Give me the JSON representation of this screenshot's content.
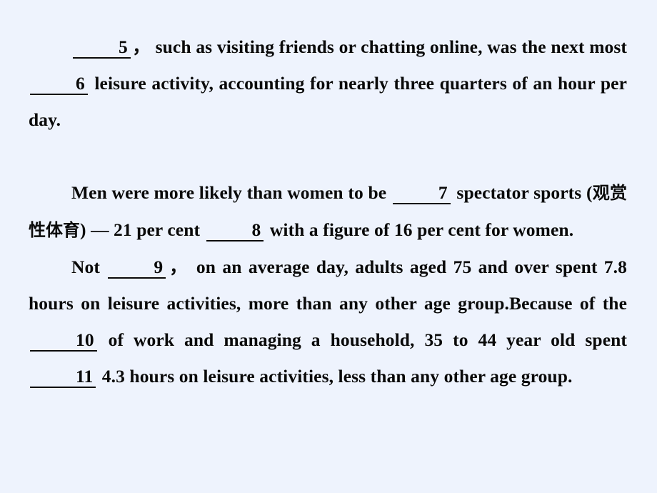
{
  "slide": {
    "background_color": "#eef3fd",
    "text_color": "#0a0a0a",
    "underline_color": "#0a0a0a"
  },
  "paragraphs": [
    {
      "id": "para-1",
      "segments": [
        {
          "type": "blank",
          "number": "5"
        },
        {
          "type": "text",
          "value": "，  such as visiting friends or chatting online, was the next most "
        },
        {
          "type": "blank",
          "number": "6"
        },
        {
          "type": "text",
          "value": " leisure activity, accounting for nearly three quarters of an hour per day."
        }
      ],
      "plain": "__5__， such as visiting friends or chatting online, was the next most __6__ leisure activity, accounting for nearly three quarters of an hour per day."
    },
    {
      "id": "para-2",
      "segments": [
        {
          "type": "text",
          "value": "Men were more likely than women to be "
        },
        {
          "type": "blank",
          "number": "7"
        },
        {
          "type": "text",
          "value": " spectator sports ("
        },
        {
          "type": "chinese",
          "value": "观赏性体育"
        },
        {
          "type": "text",
          "value": ") — 21 per cent "
        },
        {
          "type": "blank",
          "number": "8"
        },
        {
          "type": "text",
          "value": " with a figure of 16 per cent for women."
        }
      ],
      "plain": "Men were more likely than women to be __7__ spectator sports (观赏性体育) — 21 per cent __8__ with a figure of 16 per cent for women."
    },
    {
      "id": "para-3",
      "segments": [
        {
          "type": "text",
          "value": "Not "
        },
        {
          "type": "blank",
          "number": "9"
        },
        {
          "type": "text",
          "value": "，  on an average day, adults aged 75 and over spent 7.8 hours on leisure activities, more than any other age group.Because of the "
        },
        {
          "type": "blank",
          "number": "10"
        },
        {
          "type": "text",
          "value": " of work and managing a household, 35  to 44 year old spent "
        },
        {
          "type": "blank",
          "number": "11"
        },
        {
          "type": "text",
          "value": " 4.3 hours on leisure activities, less than any other age group."
        }
      ],
      "plain": "Not __9__， on an average day, adults aged 75 and over spent 7.8 hours on leisure activities, more than any other age group.Because of the __10__ of work and managing a household, 35 to 44 year old spent __11__ 4.3 hours on leisure activities, less than any other age group."
    }
  ],
  "p1": {
    "blank5": "5",
    "t1": "，",
    "t2": "  such as visiting friends or chatting online, was the next most ",
    "blank6": "6",
    "t3": " leisure activity, accounting for nearly three quarters of an hour per day."
  },
  "p2": {
    "t1": "Men were more likely than women to be ",
    "blank7": "7",
    "t2": " spectator sports (",
    "chinese": "观赏性体育",
    "t3": ") ",
    "emdash": "—",
    "t4": " 21 per cent ",
    "blank8": "8",
    "t5": " with a figure of 16 per cent for women."
  },
  "p3": {
    "t1": "Not ",
    "blank9": "9",
    "t2": "，",
    "t3": "  on an average day, adults aged 75 and over spent 7.8 hours on leisure activities, more than any other age group.Because of the ",
    "blank10": "10",
    "t4": " of work and managing a household, 35  to 44 year old spent ",
    "blank11": "11",
    "t5": " 4.3 hours on leisure activities, less than any other age group."
  },
  "blanks": [
    {
      "number": "5",
      "paragraph": 1
    },
    {
      "number": "6",
      "paragraph": 1
    },
    {
      "number": "7",
      "paragraph": 2
    },
    {
      "number": "8",
      "paragraph": 2
    },
    {
      "number": "9",
      "paragraph": 3
    },
    {
      "number": "10",
      "paragraph": 3
    },
    {
      "number": "11",
      "paragraph": 3
    }
  ]
}
